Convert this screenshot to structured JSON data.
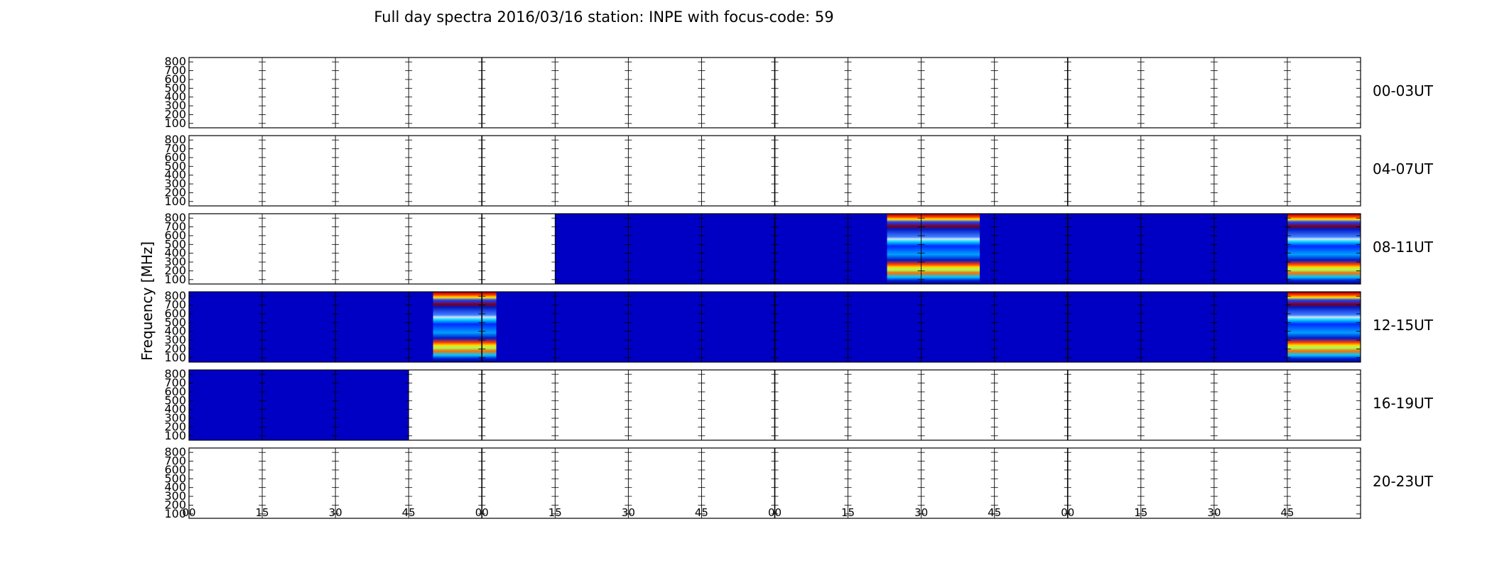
{
  "chart_data": {
    "type": "heatmap",
    "title": "Full day spectra 2016/03/16 station: INPE with focus-code: 59",
    "ylabel": "Frequency [MHz]",
    "ytick_labels": [
      "800",
      "700",
      "600",
      "500",
      "400",
      "300",
      "200",
      "100"
    ],
    "ylim": [
      50,
      850
    ],
    "xtick_labels": [
      "00",
      "15",
      "30",
      "45",
      "00",
      "15",
      "30",
      "45",
      "00",
      "15",
      "30",
      "45",
      "00",
      "15",
      "30",
      "45"
    ],
    "colormap": "jet",
    "rows": [
      {
        "label": "00-03UT",
        "segments": []
      },
      {
        "label": "04-07UT",
        "segments": []
      },
      {
        "label": "08-11UT",
        "segments": [
          {
            "start_min": 75,
            "end_min": 143,
            "kind": "quiet"
          },
          {
            "start_min": 143,
            "end_min": 162,
            "kind": "burst"
          },
          {
            "start_min": 162,
            "end_min": 225,
            "kind": "quiet"
          },
          {
            "start_min": 225,
            "end_min": 240,
            "kind": "burst"
          }
        ]
      },
      {
        "label": "12-15UT",
        "segments": [
          {
            "start_min": 0,
            "end_min": 50,
            "kind": "quiet"
          },
          {
            "start_min": 50,
            "end_min": 63,
            "kind": "burst"
          },
          {
            "start_min": 63,
            "end_min": 225,
            "kind": "quiet"
          },
          {
            "start_min": 225,
            "end_min": 240,
            "kind": "burst"
          }
        ]
      },
      {
        "label": "16-19UT",
        "segments": [
          {
            "start_min": 0,
            "end_min": 45,
            "kind": "quiet"
          }
        ]
      },
      {
        "label": "20-23UT",
        "segments": []
      }
    ]
  }
}
